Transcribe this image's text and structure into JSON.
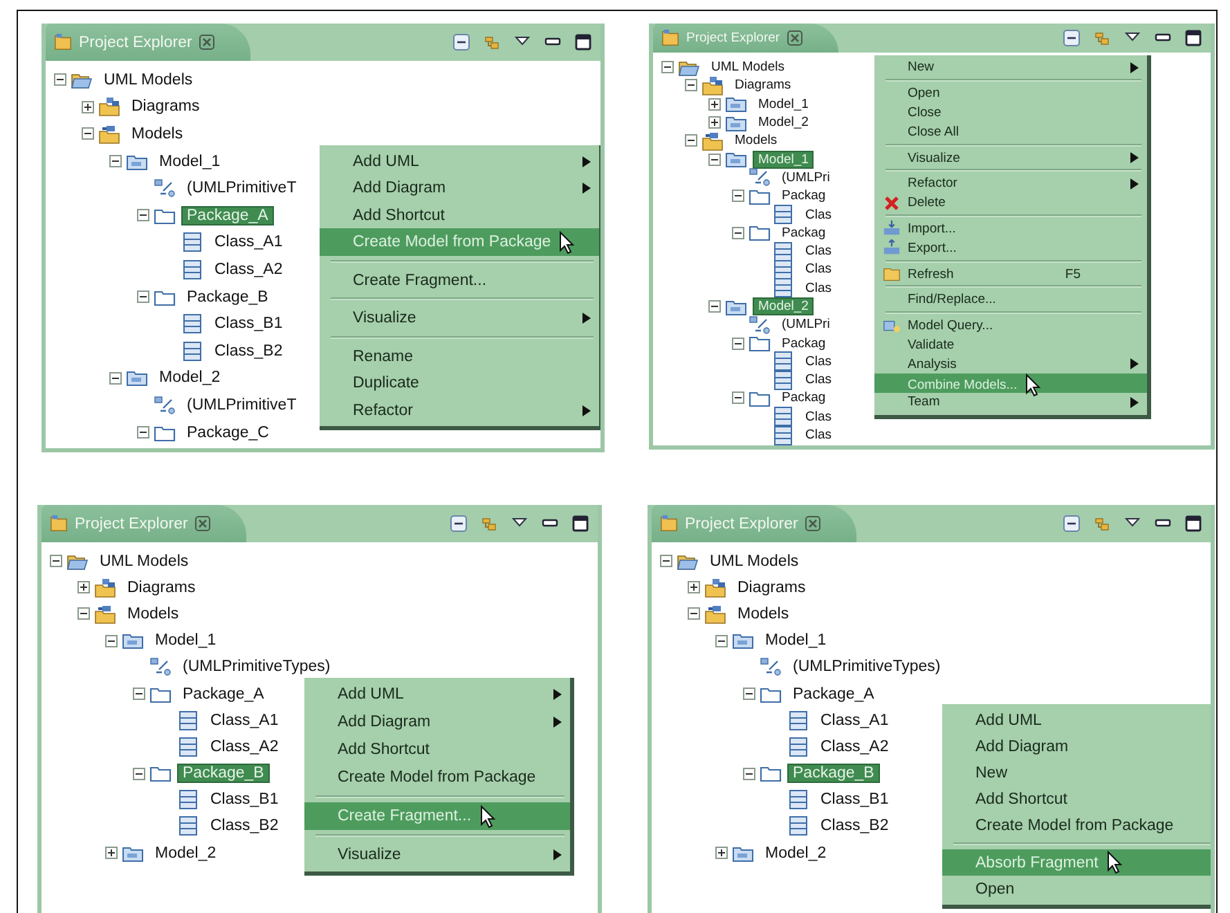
{
  "panels": [
    {
      "title": "Project Explorer",
      "tree": [
        {
          "label": "UML Models",
          "kind": "library",
          "expanded": true,
          "selected": false,
          "children": [
            {
              "label": "Diagrams",
              "kind": "diagrams",
              "expanded": false,
              "selected": false
            },
            {
              "label": "Models",
              "kind": "models",
              "expanded": true,
              "selected": false,
              "children": [
                {
                  "label": "Model_1",
                  "kind": "model",
                  "expanded": true,
                  "selected": false,
                  "children": [
                    {
                      "label": "(UMLPrimitiveT",
                      "kind": "primitive",
                      "selected": false
                    },
                    {
                      "label": "Package_A",
                      "kind": "package",
                      "expanded": true,
                      "selected": true,
                      "children": [
                        {
                          "label": "Class_A1",
                          "kind": "class",
                          "selected": false
                        },
                        {
                          "label": "Class_A2",
                          "kind": "class",
                          "selected": false
                        }
                      ]
                    },
                    {
                      "label": "Package_B",
                      "kind": "package",
                      "expanded": true,
                      "selected": false,
                      "children": [
                        {
                          "label": "Class_B1",
                          "kind": "class",
                          "selected": false
                        },
                        {
                          "label": "Class_B2",
                          "kind": "class",
                          "selected": false
                        }
                      ]
                    }
                  ]
                },
                {
                  "label": "Model_2",
                  "kind": "model",
                  "expanded": true,
                  "selected": false,
                  "children": [
                    {
                      "label": "(UMLPrimitiveT",
                      "kind": "primitive",
                      "selected": false
                    },
                    {
                      "label": "Package_C",
                      "kind": "package",
                      "expanded": true,
                      "selected": false
                    }
                  ]
                }
              ]
            }
          ]
        }
      ],
      "menu": {
        "groups": [
          {
            "items": [
              {
                "label": "Add UML",
                "submenu": true,
                "selected": false
              },
              {
                "label": "Add Diagram",
                "submenu": true,
                "selected": false
              },
              {
                "label": "Add Shortcut",
                "submenu": false,
                "selected": false
              },
              {
                "label": "Create Model from Package",
                "submenu": false,
                "selected": true
              }
            ]
          },
          {
            "items": [
              {
                "label": "Create Fragment...",
                "submenu": false,
                "selected": false
              }
            ]
          },
          {
            "items": [
              {
                "label": "Visualize",
                "submenu": true,
                "selected": false
              }
            ]
          },
          {
            "items": [
              {
                "label": "Rename",
                "submenu": false,
                "selected": false
              },
              {
                "label": "Duplicate",
                "submenu": false,
                "selected": false
              },
              {
                "label": "Refactor",
                "submenu": true,
                "selected": false
              }
            ]
          }
        ]
      }
    },
    {
      "title": "Project Explorer",
      "tree": [
        {
          "label": "UML Models",
          "kind": "library",
          "expanded": true,
          "selected": false,
          "children": [
            {
              "label": "Diagrams",
              "kind": "diagrams",
              "expanded": true,
              "selected": false,
              "children": [
                {
                  "label": "Model_1",
                  "kind": "model",
                  "expanded": false,
                  "selected": false
                },
                {
                  "label": "Model_2",
                  "kind": "model",
                  "expanded": false,
                  "selected": false
                }
              ]
            },
            {
              "label": "Models",
              "kind": "models",
              "expanded": true,
              "selected": false,
              "children": [
                {
                  "label": "Model_1",
                  "kind": "model",
                  "expanded": true,
                  "selected": true,
                  "children": [
                    {
                      "label": "(UMLPri",
                      "kind": "primitive",
                      "selected": false
                    },
                    {
                      "label": "Packag",
                      "kind": "package",
                      "expanded": true,
                      "selected": false,
                      "children": [
                        {
                          "label": "Clas",
                          "kind": "class",
                          "selected": false
                        }
                      ]
                    },
                    {
                      "label": "Packag",
                      "kind": "package",
                      "expanded": true,
                      "selected": false,
                      "children": [
                        {
                          "label": "Clas",
                          "kind": "class",
                          "selected": false
                        },
                        {
                          "label": "Clas",
                          "kind": "class",
                          "selected": false
                        },
                        {
                          "label": "Clas",
                          "kind": "class",
                          "selected": false
                        }
                      ]
                    }
                  ]
                },
                {
                  "label": "Model_2",
                  "kind": "model",
                  "expanded": true,
                  "selected": true,
                  "children": [
                    {
                      "label": "(UMLPri",
                      "kind": "primitive",
                      "selected": false
                    },
                    {
                      "label": "Packag",
                      "kind": "package",
                      "expanded": true,
                      "selected": false,
                      "children": [
                        {
                          "label": "Clas",
                          "kind": "class",
                          "selected": false
                        },
                        {
                          "label": "Clas",
                          "kind": "class",
                          "selected": false
                        }
                      ]
                    },
                    {
                      "label": "Packag",
                      "kind": "package",
                      "expanded": true,
                      "selected": false,
                      "children": [
                        {
                          "label": "Clas",
                          "kind": "class",
                          "selected": false
                        },
                        {
                          "label": "Clas",
                          "kind": "class",
                          "selected": false
                        }
                      ]
                    }
                  ]
                }
              ]
            }
          ]
        }
      ],
      "menu": {
        "groups": [
          {
            "items": [
              {
                "label": "New",
                "submenu": true,
                "selected": false
              }
            ]
          },
          {
            "items": [
              {
                "label": "Open",
                "submenu": false,
                "selected": false
              },
              {
                "label": "Close",
                "submenu": false,
                "selected": false
              },
              {
                "label": "Close All",
                "submenu": false,
                "selected": false
              }
            ]
          },
          {
            "items": [
              {
                "label": "Visualize",
                "submenu": true,
                "selected": false
              }
            ]
          },
          {
            "items": [
              {
                "label": "Refactor",
                "submenu": true,
                "selected": false
              },
              {
                "label": "Delete",
                "kind": "delete",
                "submenu": false,
                "selected": false
              }
            ]
          },
          {
            "items": [
              {
                "label": "Import...",
                "kind": "import",
                "submenu": false,
                "selected": false
              },
              {
                "label": "Export...",
                "kind": "export",
                "submenu": false,
                "selected": false
              }
            ]
          },
          {
            "items": [
              {
                "label": "Refresh",
                "kind": "refresh",
                "shortcut": "F5",
                "submenu": false,
                "selected": false
              }
            ]
          },
          {
            "items": [
              {
                "label": "Find/Replace...",
                "submenu": false,
                "selected": false
              }
            ]
          },
          {
            "items": [
              {
                "label": "Model Query...",
                "kind": "query",
                "submenu": false,
                "selected": false
              },
              {
                "label": "Validate",
                "submenu": false,
                "selected": false
              },
              {
                "label": "Analysis",
                "submenu": true,
                "selected": false
              },
              {
                "label": "Combine Models...",
                "submenu": false,
                "selected": true
              },
              {
                "label": "Team",
                "submenu": true,
                "selected": false
              }
            ]
          }
        ]
      }
    },
    {
      "title": "Project Explorer",
      "tree": [
        {
          "label": "UML Models",
          "kind": "library",
          "expanded": true,
          "selected": false,
          "children": [
            {
              "label": "Diagrams",
              "kind": "diagrams",
              "expanded": false,
              "selected": false
            },
            {
              "label": "Models",
              "kind": "models",
              "expanded": true,
              "selected": false,
              "children": [
                {
                  "label": "Model_1",
                  "kind": "model",
                  "expanded": true,
                  "selected": false,
                  "children": [
                    {
                      "label": "(UMLPrimitiveTypes)",
                      "kind": "primitive",
                      "selected": false
                    },
                    {
                      "label": "Package_A",
                      "kind": "package",
                      "expanded": true,
                      "selected": false,
                      "children": [
                        {
                          "label": "Class_A1",
                          "kind": "class",
                          "selected": false
                        },
                        {
                          "label": "Class_A2",
                          "kind": "class",
                          "selected": false
                        }
                      ]
                    },
                    {
                      "label": "Package_B",
                      "kind": "package",
                      "expanded": true,
                      "selected": true,
                      "children": [
                        {
                          "label": "Class_B1",
                          "kind": "class",
                          "selected": false
                        },
                        {
                          "label": "Class_B2",
                          "kind": "class",
                          "selected": false
                        }
                      ]
                    }
                  ]
                },
                {
                  "label": "Model_2",
                  "kind": "model",
                  "expanded": false,
                  "selected": false
                }
              ]
            }
          ]
        }
      ],
      "menu": {
        "groups": [
          {
            "items": [
              {
                "label": "Add UML",
                "submenu": true,
                "selected": false
              },
              {
                "label": "Add Diagram",
                "submenu": true,
                "selected": false
              },
              {
                "label": "Add Shortcut",
                "submenu": false,
                "selected": false
              },
              {
                "label": "Create Model from Package",
                "submenu": false,
                "selected": false
              }
            ]
          },
          {
            "items": [
              {
                "label": "Create Fragment...",
                "submenu": false,
                "selected": true
              }
            ]
          },
          {
            "items": [
              {
                "label": "Visualize",
                "submenu": true,
                "selected": false
              }
            ]
          }
        ]
      }
    },
    {
      "title": "Project Explorer",
      "tree": [
        {
          "label": "UML Models",
          "kind": "library",
          "expanded": true,
          "selected": false,
          "children": [
            {
              "label": "Diagrams",
              "kind": "diagrams",
              "expanded": false,
              "selected": false
            },
            {
              "label": "Models",
              "kind": "models",
              "expanded": true,
              "selected": false,
              "children": [
                {
                  "label": "Model_1",
                  "kind": "model",
                  "expanded": true,
                  "selected": false,
                  "children": [
                    {
                      "label": "(UMLPrimitiveTypes)",
                      "kind": "primitive",
                      "selected": false
                    },
                    {
                      "label": "Package_A",
                      "kind": "package",
                      "expanded": true,
                      "selected": false,
                      "children": [
                        {
                          "label": "Class_A1",
                          "kind": "class",
                          "selected": false
                        },
                        {
                          "label": "Class_A2",
                          "kind": "class",
                          "selected": false
                        }
                      ]
                    },
                    {
                      "label": "Package_B",
                      "kind": "package",
                      "expanded": true,
                      "selected": true,
                      "children": [
                        {
                          "label": "Class_B1",
                          "kind": "class",
                          "selected": false
                        },
                        {
                          "label": "Class_B2",
                          "kind": "class",
                          "selected": false
                        }
                      ]
                    }
                  ]
                },
                {
                  "label": "Model_2",
                  "kind": "model",
                  "expanded": false,
                  "selected": false
                }
              ]
            }
          ]
        }
      ],
      "menu": {
        "groups": [
          {
            "items": [
              {
                "label": "Add UML",
                "submenu": false,
                "selected": false
              },
              {
                "label": "Add Diagram",
                "submenu": false,
                "selected": false
              },
              {
                "label": "New",
                "submenu": false,
                "selected": false
              },
              {
                "label": "Add Shortcut",
                "submenu": false,
                "selected": false
              },
              {
                "label": "Create Model from Package",
                "submenu": false,
                "selected": false
              }
            ]
          },
          {
            "items": [
              {
                "label": "Absorb Fragment",
                "submenu": false,
                "selected": true
              },
              {
                "label": "Open",
                "submenu": false,
                "selected": false
              }
            ]
          }
        ]
      }
    }
  ]
}
